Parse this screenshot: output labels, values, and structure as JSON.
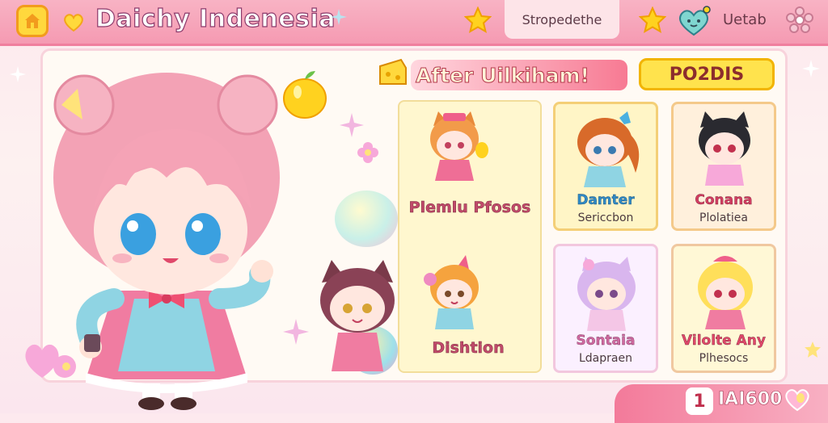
{
  "app": {
    "title": "Daichy Indenesia"
  },
  "topbar": {
    "center_label": "Stropedethe",
    "user_label": "Uetab"
  },
  "panel": {
    "title": "After Uilkiham!",
    "points_label": "PO2DIS"
  },
  "cards": [
    {
      "name": "Plemlu Pfosos",
      "role": ""
    },
    {
      "name": "Damter",
      "role": "Sericcbon"
    },
    {
      "name": "Conana",
      "role": "Plolatiea"
    },
    {
      "name": "Dishtion",
      "role": ""
    },
    {
      "name": "Sontaia",
      "role": "Ldapraen"
    },
    {
      "name": "Vilolte Any",
      "role": "Plhesocs"
    }
  ],
  "bottom": {
    "count": "1",
    "score": "IAI600"
  },
  "colors": {
    "topbar": "#f59ab2",
    "title_pill": "#f77a93",
    "points_button": "#ffe34d",
    "card_yellow": "#fff5c6"
  },
  "icons": [
    "home-icon",
    "heart-icon",
    "star-icon",
    "sparkle-icon",
    "heart-face-icon",
    "gear-icon",
    "cheese-icon",
    "apple-icon"
  ]
}
